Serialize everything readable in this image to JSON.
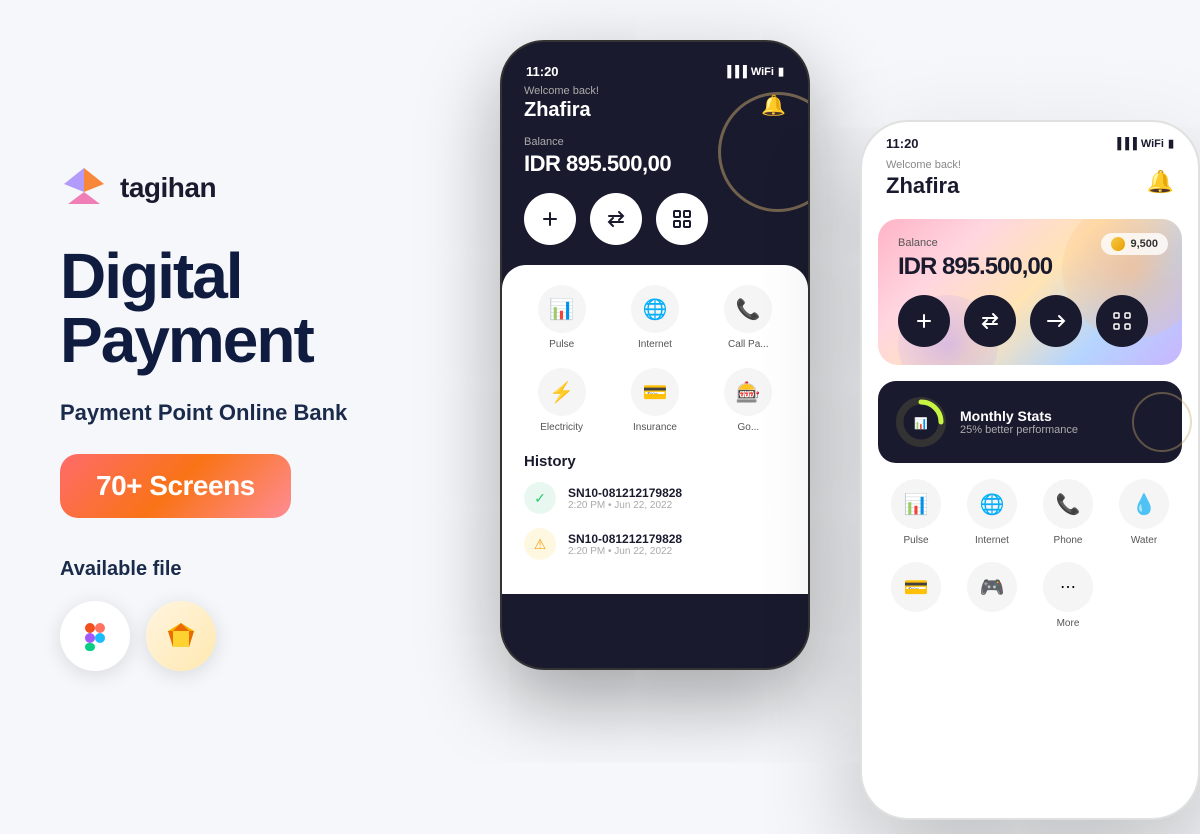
{
  "brand": {
    "name": "tagihan",
    "logo_alt": "tagihan logo"
  },
  "hero": {
    "headline_line1": "Digital",
    "headline_line2": "Payment",
    "subtitle": "Payment Point Online Bank",
    "screens_badge": "70+ Screens",
    "available_label": "Available file"
  },
  "file_tools": {
    "figma_label": "Figma",
    "sketch_label": "Sketch"
  },
  "phone_back": {
    "time": "11:20",
    "welcome": "Welcome back!",
    "user": "Zhafira",
    "balance_label": "Balance",
    "balance": "IDR 895.500,00",
    "services": [
      {
        "icon": "📊",
        "label": "Pulse"
      },
      {
        "icon": "🌐",
        "label": "Internet"
      },
      {
        "icon": "📞",
        "label": "Call Pa..."
      },
      {
        "icon": "⚡",
        "label": "Electricity"
      },
      {
        "icon": "💳",
        "label": "Insurance"
      },
      {
        "icon": "🎰",
        "label": "Go..."
      }
    ],
    "history_title": "History",
    "history_items": [
      {
        "sn": "SN10-081212179828",
        "time": "2:20 PM • Jun 22, 2022",
        "status": "success"
      },
      {
        "sn": "SN10-081212179828",
        "time": "2:20 PM • Jun 22, 2022",
        "status": "warning"
      }
    ]
  },
  "phone_front": {
    "time": "11:20",
    "welcome": "Welcome back!",
    "user": "Zhafira",
    "balance_label": "Balance",
    "balance": "IDR 895.500,00",
    "coin_value": "9,500",
    "monthly_stats_title": "Monthly Stats",
    "monthly_stats_sub": "25% better performance",
    "services_row1": [
      {
        "icon": "📊",
        "label": "Pulse"
      },
      {
        "icon": "🌐",
        "label": "Internet"
      },
      {
        "icon": "📞",
        "label": "Phone"
      },
      {
        "icon": "💧",
        "label": "Water"
      }
    ],
    "services_row2": [
      {
        "icon": "💳",
        "label": ""
      },
      {
        "icon": "🎮",
        "label": ""
      },
      {
        "icon": "⋯",
        "label": "More"
      }
    ]
  },
  "actions_dark": [
    "➕",
    "⇄",
    "↗"
  ],
  "actions_light": [
    "➕",
    "⇄",
    "⬆",
    "⊡"
  ]
}
